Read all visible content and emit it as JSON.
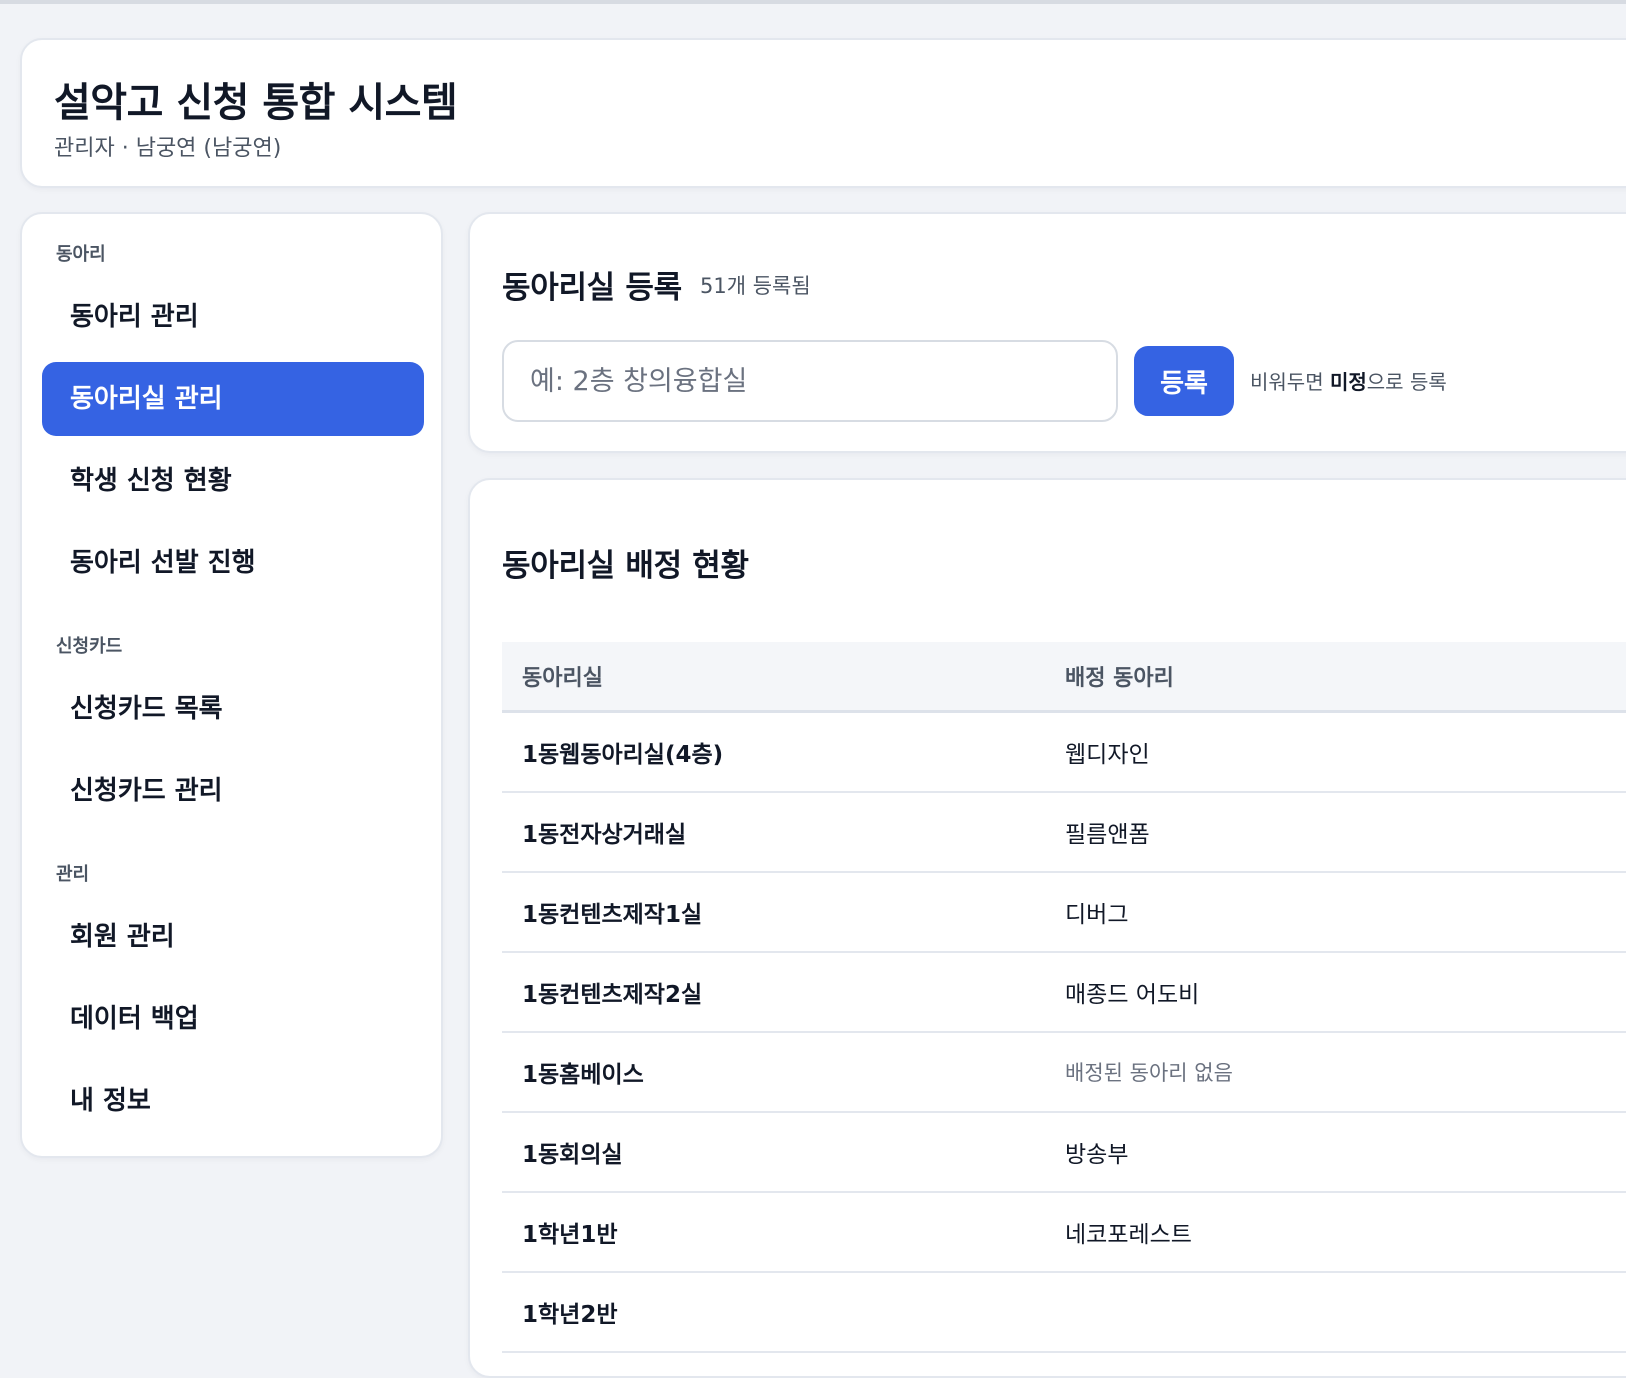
{
  "header": {
    "title": "설악고 신청 통합 시스템",
    "user_line": "관리자 · 남궁연 (남궁연)"
  },
  "sidebar": {
    "sections": [
      {
        "label": "동아리"
      },
      {
        "label": "신청카드"
      },
      {
        "label": "관리"
      }
    ],
    "items": [
      {
        "label": "동아리 관리"
      },
      {
        "label": "동아리실 관리",
        "active": true
      },
      {
        "label": "학생 신청 현황"
      },
      {
        "label": "동아리 선발 진행"
      },
      {
        "label": "신청카드 목록"
      },
      {
        "label": "신청카드 관리"
      },
      {
        "label": "회원 관리"
      },
      {
        "label": "데이터 백업"
      },
      {
        "label": "내 정보"
      }
    ]
  },
  "register": {
    "title": "동아리실 등록",
    "count": "51개 등록됨",
    "input_value": "",
    "input_placeholder": "예: 2층 창의융합실",
    "button_label": "등록",
    "hint_before": "비워두면 ",
    "hint_strong": "미정",
    "hint_after": "으로 등록"
  },
  "assignment": {
    "title": "동아리실 배정 현황",
    "columns": [
      "동아리실",
      "배정 동아리"
    ],
    "rows": [
      {
        "room": "1동웹동아리실(4층)",
        "club": "웹디자인"
      },
      {
        "room": "1동전자상거래실",
        "club": "필름앤폼"
      },
      {
        "room": "1동컨텐츠제작1실",
        "club": "디버그"
      },
      {
        "room": "1동컨텐츠제작2실",
        "club": "매종드 어도비"
      },
      {
        "room": "1동홈베이스",
        "club": "배정된 동아리 없음",
        "empty": true
      },
      {
        "room": "1동회의실",
        "club": "방송부"
      },
      {
        "room": "1학년1반",
        "club": "네코포레스트"
      },
      {
        "room": "1학년2반",
        "club": ""
      }
    ]
  }
}
